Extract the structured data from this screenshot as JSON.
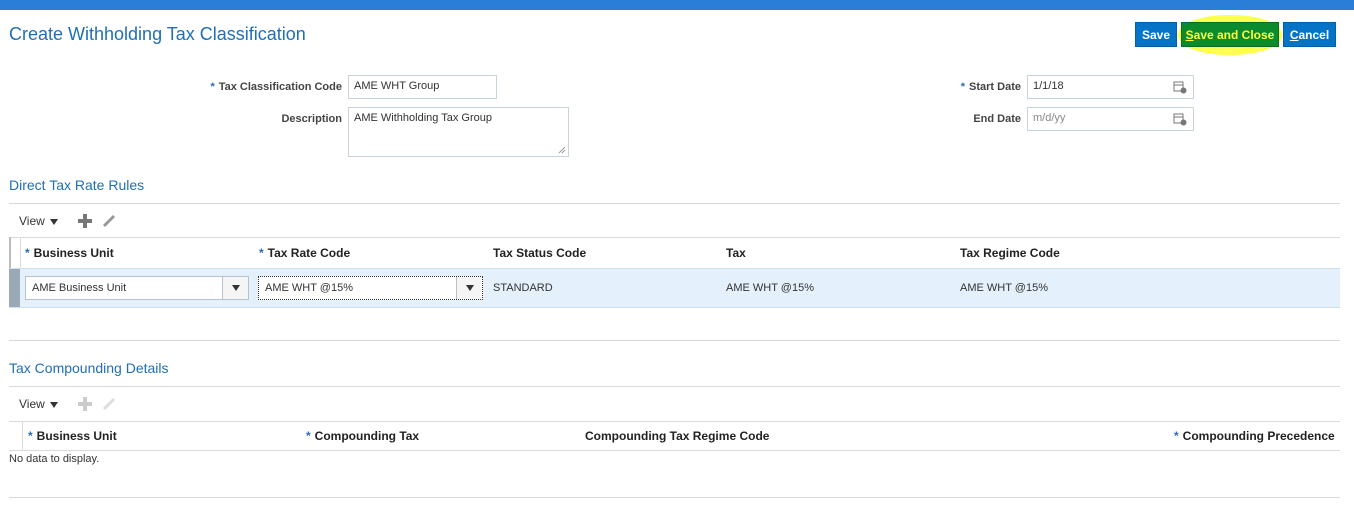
{
  "header": {
    "title": "Create Withholding Tax Classification",
    "buttons": {
      "save": "Save",
      "save_and_close_first": "S",
      "save_and_close_rest": "ave and Close",
      "cancel_first": "C",
      "cancel_rest": "ancel"
    }
  },
  "form": {
    "tax_classification_code_label": "Tax Classification Code",
    "tax_classification_code_value": "AME WHT Group",
    "description_label": "Description",
    "description_value": "AME Withholding Tax Group",
    "start_date_label": "Start Date",
    "start_date_value": "1/1/18",
    "end_date_label": "End Date",
    "end_date_placeholder": "m/d/yy"
  },
  "direct_rules": {
    "title": "Direct Tax Rate Rules",
    "toolbar_view": "View",
    "columns": [
      "Business Unit",
      "Tax Rate Code",
      "Tax Status Code",
      "Tax",
      "Tax Regime Code"
    ],
    "row": {
      "business_unit": "AME Business Unit",
      "tax_rate_code": "AME WHT @15%",
      "tax_status_code": "STANDARD",
      "tax": "AME WHT @15%",
      "tax_regime_code": "AME WHT @15%"
    }
  },
  "compounding": {
    "title": "Tax Compounding Details",
    "toolbar_view": "View",
    "columns": [
      "Business Unit",
      "Compounding Tax",
      "Compounding Tax Regime Code",
      "Compounding Precedence"
    ],
    "empty_text": "No data to display."
  },
  "colors": {
    "accent": "#0574c6",
    "title": "#1f6fb5",
    "highlight": "#ffff3b",
    "selected_row": "#e4f0fb"
  }
}
